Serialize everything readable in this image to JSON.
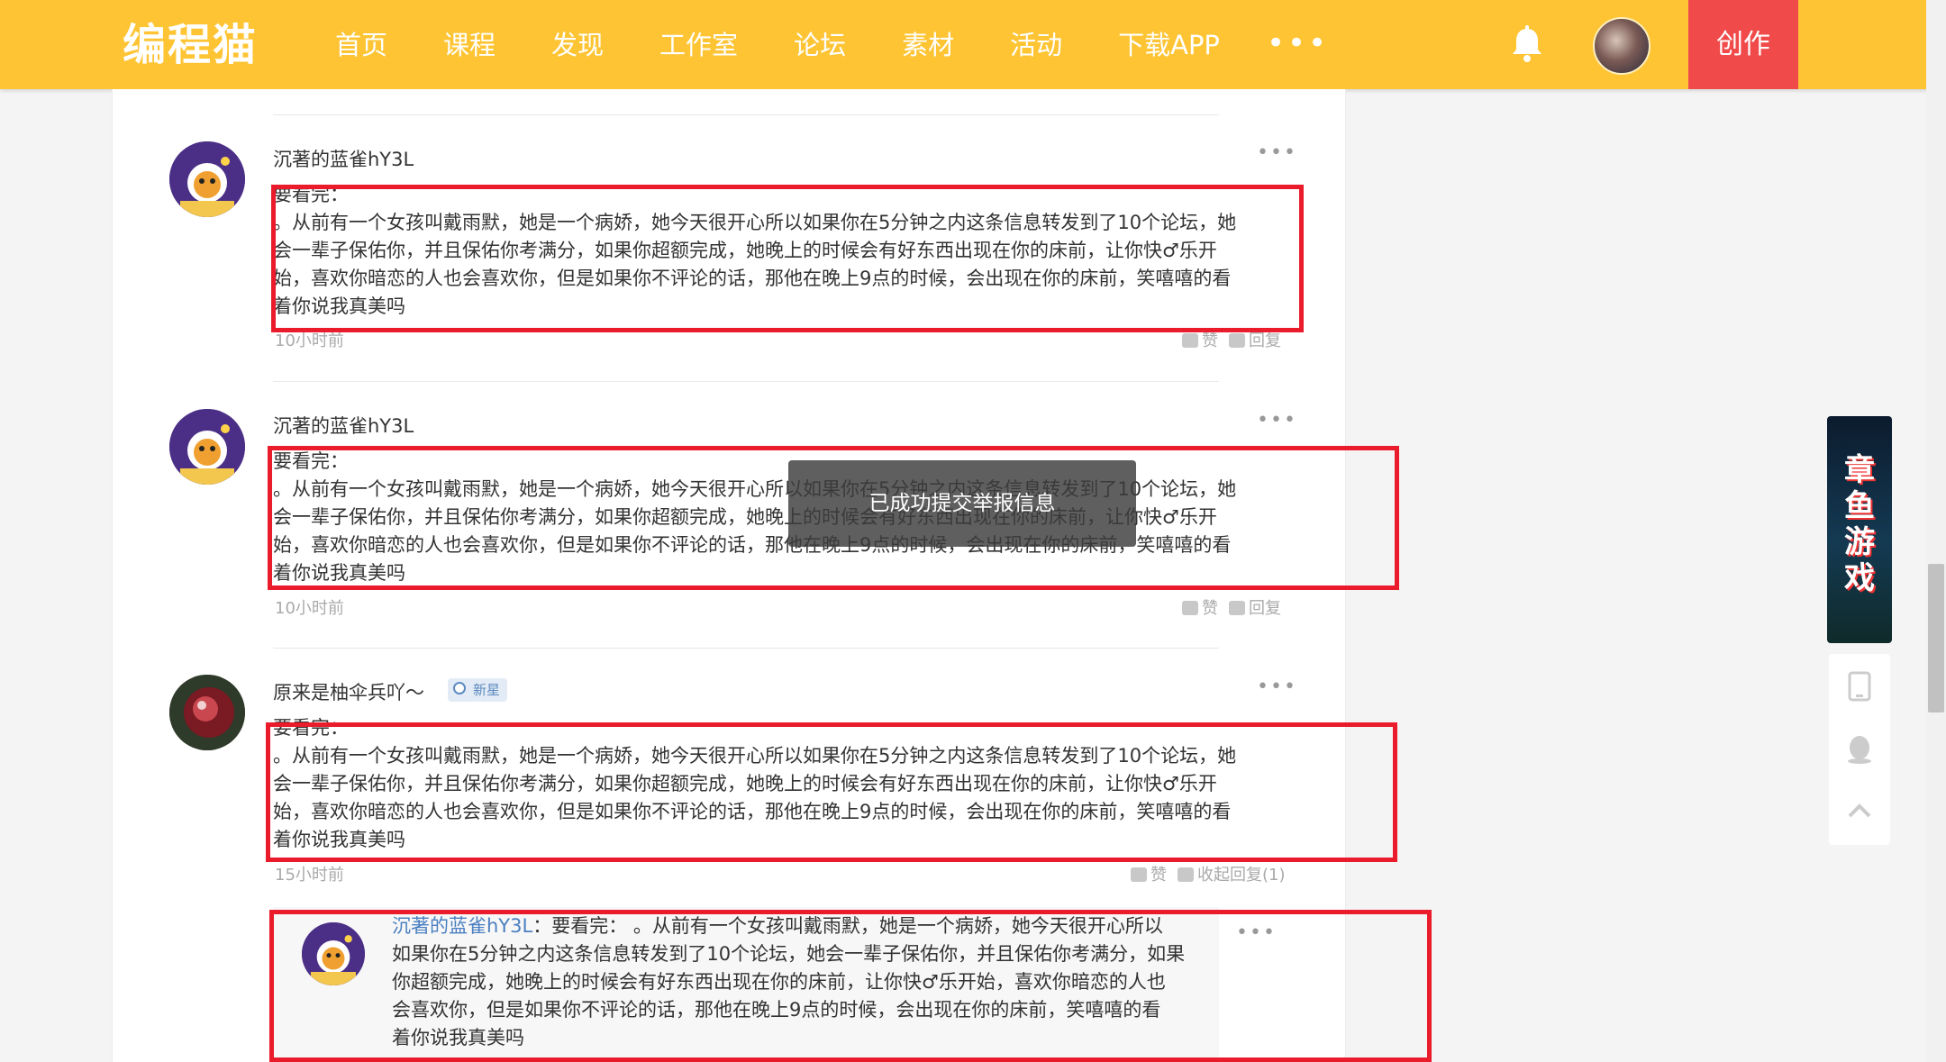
{
  "header": {
    "logo": "编程猫",
    "nav": [
      "首页",
      "课程",
      "发现",
      "工作室",
      "论坛",
      "素材",
      "活动",
      "下载APP"
    ],
    "more": "•••",
    "create": "创作"
  },
  "colors": {
    "header_bg": "#fec433",
    "create_bg": "#f04a4a",
    "highlight_box": "#ea1b2a",
    "link": "#4a7fc1"
  },
  "comments": [
    {
      "user": "沉著的蓝雀hY3L",
      "line0": "要看完：",
      "line1": "。从前有一个女孩叫戴雨默，她是一个病娇，她今天很开心所以如果你在5分钟之内这条信息转发到了10个论坛，她",
      "line2": "会一辈子保佑你，并且保佑你考满分，如果你超额完成，她晚上的时候会有好东西出现在你的床前，让你快♂乐开",
      "line3": "始，喜欢你暗恋的人也会喜欢你，但是如果你不评论的话，那他在晚上9点的时候，会出现在你的床前，笑嘻嘻的看",
      "line4": "着你说我真美吗",
      "time": "10小时前",
      "like": "赞",
      "reply": "回复"
    },
    {
      "user": "沉著的蓝雀hY3L",
      "line0": "要看完：",
      "line1": "。从前有一个女孩叫戴雨默，她是一个病娇，她今天很开心所以如果你在5分钟之内这条信息转发到了10个论坛，她",
      "line2": "会一辈子保佑你，并且保佑你考满分，如果你超额完成，她晚上的时候会有好东西出现在你的床前，让你快♂乐开",
      "line3": "始，喜欢你暗恋的人也会喜欢你，但是如果你不评论的话，那他在晚上9点的时候，会出现在你的床前，笑嘻嘻的看",
      "line4": "着你说我真美吗",
      "time": "10小时前",
      "like": "赞",
      "reply": "回复"
    },
    {
      "user": "原来是柚伞兵吖～",
      "badge": "新星",
      "line0": "要看完：",
      "line1": "。从前有一个女孩叫戴雨默，她是一个病娇，她今天很开心所以如果你在5分钟之内这条信息转发到了10个论坛，她",
      "line2": "会一辈子保佑你，并且保佑你考满分，如果你超额完成，她晚上的时候会有好东西出现在你的床前，让你快♂乐开",
      "line3": "始，喜欢你暗恋的人也会喜欢你，但是如果你不评论的话，那他在晚上9点的时候，会出现在你的床前，笑嘻嘻的看",
      "line4": "着你说我真美吗",
      "time": "15小时前",
      "like": "赞",
      "reply": "收起回复(1)"
    }
  ],
  "reply": {
    "user": "沉著的蓝雀hY3L",
    "sep": "：",
    "line1": "要看完：  。从前有一个女孩叫戴雨默，她是一个病娇，她今天很开心所以",
    "line2": "如果你在5分钟之内这条信息转发到了10个论坛，她会一辈子保佑你，并且保佑你考满分，如果",
    "line3": "你超额完成，她晚上的时候会有好东西出现在你的床前，让你快♂乐开始，喜欢你暗恋的人也",
    "line4": "会喜欢你，但是如果你不评论的话，那他在晚上9点的时候，会出现在你的床前，笑嘻嘻的看",
    "line5": "着你说我真美吗"
  },
  "toast": "已成功提交举报信息",
  "ad": {
    "text": "章鱼游戏"
  }
}
